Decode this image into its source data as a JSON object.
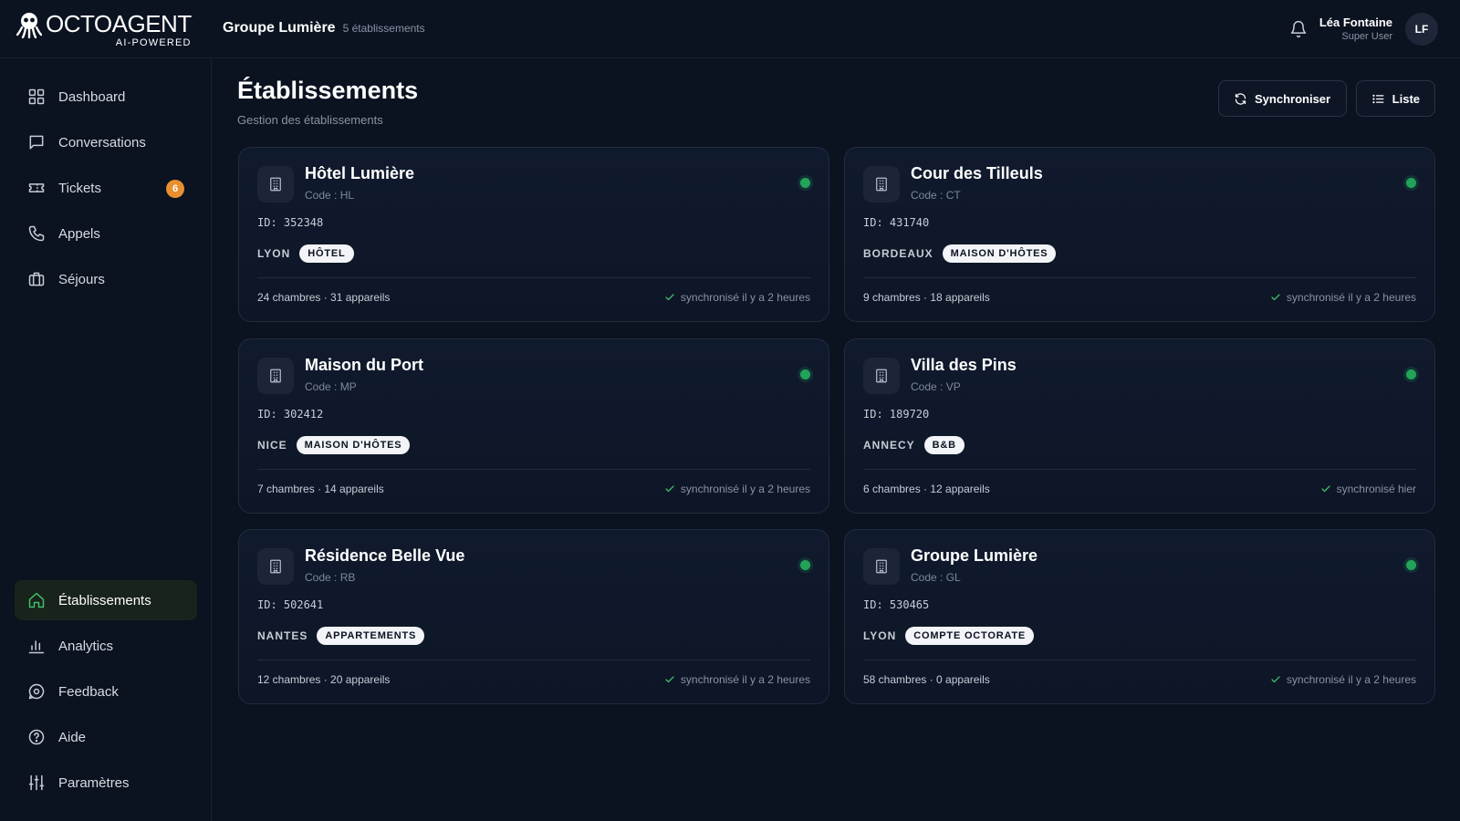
{
  "app": {
    "logo_name": "OCTOAGENT",
    "logo_sub": "AI-POWERED"
  },
  "header": {
    "org_name": "Groupe Lumière",
    "org_count": "5 établissements",
    "user_name": "Léa Fontaine",
    "user_role": "Super User",
    "avatar_initials": "LF"
  },
  "sidebar": {
    "items": [
      {
        "label": "Dashboard",
        "icon": "grid-icon"
      },
      {
        "label": "Conversations",
        "icon": "chat-icon"
      },
      {
        "label": "Tickets",
        "icon": "ticket-icon",
        "badge": "6"
      },
      {
        "label": "Appels",
        "icon": "phone-icon"
      },
      {
        "label": "Séjours",
        "icon": "suitcase-icon"
      },
      {
        "label": "Établissements",
        "icon": "home-icon",
        "active": true
      },
      {
        "label": "Analytics",
        "icon": "bar-chart-icon"
      },
      {
        "label": "Feedback",
        "icon": "feedback-icon"
      },
      {
        "label": "Aide",
        "icon": "help-icon"
      },
      {
        "label": "Paramètres",
        "icon": "sliders-icon"
      }
    ]
  },
  "main": {
    "title": "Établissements",
    "subtitle": "Gestion des établissements",
    "sync_button": "Synchroniser",
    "list_button": "Liste"
  },
  "colors": {
    "accent_status": "#22a35a",
    "badge": "#e8902f",
    "background": "#0b1220"
  },
  "establishments": [
    {
      "name": "Hôtel Lumière",
      "code": "Code : HL",
      "id": "ID: 352348",
      "city": "LYON",
      "type": "HÔTEL",
      "stats": "24 chambres · 31 appareils",
      "sync": "synchronisé il y a 2 heures"
    },
    {
      "name": "Cour des Tilleuls",
      "code": "Code : CT",
      "id": "ID: 431740",
      "city": "BORDEAUX",
      "type": "MAISON D'HÔTES",
      "stats": "9 chambres · 18 appareils",
      "sync": "synchronisé il y a 2 heures"
    },
    {
      "name": "Maison du Port",
      "code": "Code : MP",
      "id": "ID: 302412",
      "city": "NICE",
      "type": "MAISON D'HÔTES",
      "stats": "7 chambres · 14 appareils",
      "sync": "synchronisé il y a 2 heures"
    },
    {
      "name": "Villa des Pins",
      "code": "Code : VP",
      "id": "ID: 189720",
      "city": "ANNECY",
      "type": "B&B",
      "stats": "6 chambres · 12 appareils",
      "sync": "synchronisé hier"
    },
    {
      "name": "Résidence Belle Vue",
      "code": "Code : RB",
      "id": "ID: 502641",
      "city": "NANTES",
      "type": "APPARTEMENTS",
      "stats": "12 chambres · 20 appareils",
      "sync": "synchronisé il y a 2 heures"
    },
    {
      "name": "Groupe Lumière",
      "code": "Code : GL",
      "id": "ID: 530465",
      "city": "LYON",
      "type": "COMPTE OCTORATE",
      "stats": "58 chambres · 0 appareils",
      "sync": "synchronisé il y a 2 heures"
    }
  ]
}
